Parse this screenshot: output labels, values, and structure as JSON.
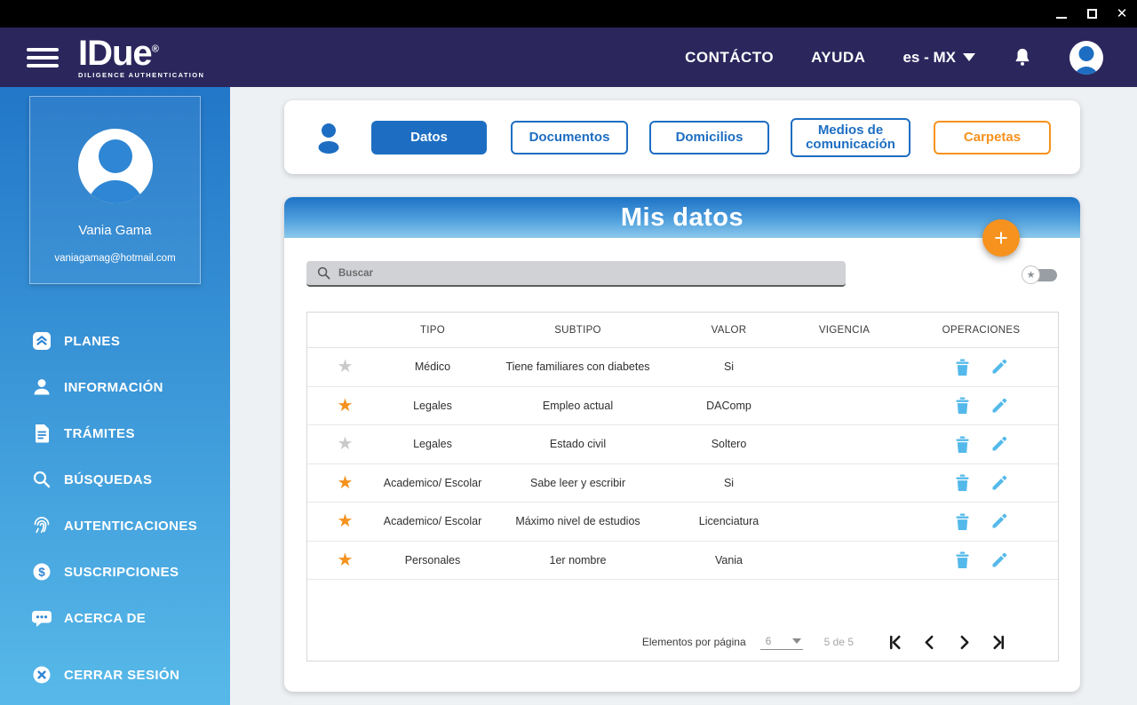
{
  "titlebar": {
    "minimize": "minimize",
    "maximize": "maximize",
    "close": "✕"
  },
  "header": {
    "logo": {
      "title": "IDue",
      "registered": "®",
      "subtitle": "DILIGENCE AUTHENTICATION"
    },
    "nav": {
      "contact": "CONTÁCTO",
      "help": "AYUDA",
      "language": "es - MX"
    }
  },
  "sidebar": {
    "user": {
      "name": "Vania Gama",
      "email": "vaniagamag@hotmail.com"
    },
    "items": [
      {
        "label": "PLANES",
        "icon": "plans-icon"
      },
      {
        "label": "INFORMACIÓN",
        "icon": "person-icon"
      },
      {
        "label": "TRÁMITES",
        "icon": "document-icon"
      },
      {
        "label": "BÚSQUEDAS",
        "icon": "search-icon"
      },
      {
        "label": "AUTENTICACIONES",
        "icon": "fingerprint-icon"
      },
      {
        "label": "SUSCRIPCIONES",
        "icon": "dollar-icon"
      },
      {
        "label": "ACERCA DE",
        "icon": "chat-icon"
      }
    ],
    "logout": {
      "label": "CERRAR SESIÓN",
      "icon": "logout-icon"
    }
  },
  "tabs": {
    "items": [
      {
        "label": "Datos",
        "active": true
      },
      {
        "label": "Documentos",
        "active": false
      },
      {
        "label": "Domicilios",
        "active": false
      },
      {
        "label": "Medios de comunicación",
        "active": false
      },
      {
        "label": "Carpetas",
        "active": false
      }
    ]
  },
  "panel": {
    "title": "Mis datos",
    "add_button": "+",
    "search_placeholder": "Buscar",
    "star_glyph": "★",
    "table": {
      "columns": [
        "TIPO",
        "SUBTIPO",
        "VALOR",
        "VIGENCIA",
        "OPERACIONES"
      ],
      "rows": [
        {
          "starred": false,
          "tipo": "Médico",
          "subtipo": "Tiene familiares con diabetes",
          "valor": "Si",
          "vigencia": ""
        },
        {
          "starred": true,
          "tipo": "Legales",
          "subtipo": "Empleo actual",
          "valor": "DAComp",
          "vigencia": ""
        },
        {
          "starred": false,
          "tipo": "Legales",
          "subtipo": "Estado civil",
          "valor": "Soltero",
          "vigencia": ""
        },
        {
          "starred": true,
          "tipo": "Academico/ Escolar",
          "subtipo": "Sabe leer y escribir",
          "valor": "Si",
          "vigencia": ""
        },
        {
          "starred": true,
          "tipo": "Academico/ Escolar",
          "subtipo": "Máximo nivel de estudios",
          "valor": "Licenciatura",
          "vigencia": ""
        },
        {
          "starred": true,
          "tipo": "Personales",
          "subtipo": "1er nombre",
          "valor": "Vania",
          "vigencia": ""
        }
      ]
    },
    "pagination": {
      "items_per_page_label": "Elementos por página",
      "items_per_page_value": "6",
      "range_label": "5 de 5"
    }
  },
  "colors": {
    "accent_blue": "#1d6ec2",
    "accent_orange": "#f6921e",
    "icon_blue": "#54b9ea",
    "header_navy": "#2b265c",
    "sidebar_top": "#2277c8",
    "sidebar_bottom": "#57b9e9"
  }
}
